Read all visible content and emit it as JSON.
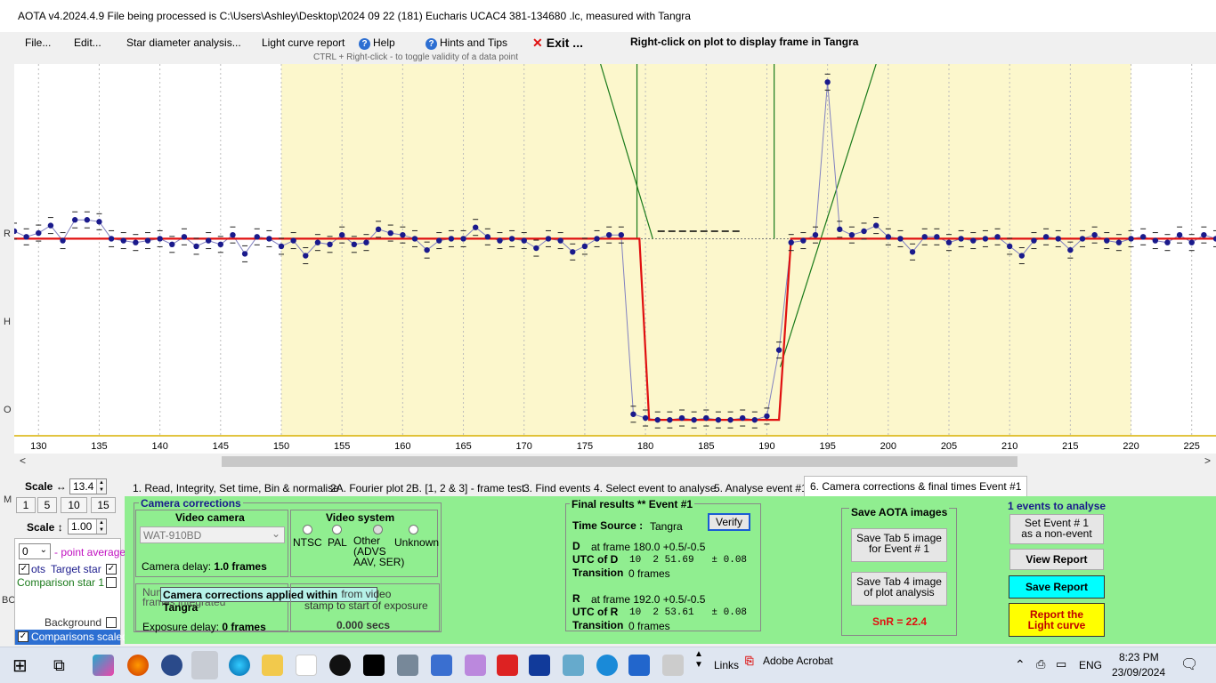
{
  "window": {
    "title": "AOTA v4.2024.4.9   File being processed is C:\\Users\\Ashley\\Desktop\\2024 09 22 (181) Eucharis UCAC4 381-134680 .lc, measured with Tangra"
  },
  "menu": {
    "file": "File...",
    "edit": "Edit...",
    "star_diameter": "Star diameter analysis...",
    "light_curve_report": "Light curve report",
    "help": "Help",
    "hints": "Hints and Tips",
    "exit": "Exit ...",
    "ctrl_hint": "CTRL + Right-click   -  to toggle validity of a data point",
    "right_click_note": "Right-click on plot to display frame in Tangra"
  },
  "left_strip_letters": [
    "R",
    "H",
    "O",
    "M",
    "BC"
  ],
  "plot": {
    "colors": {
      "background": "#ffffff",
      "event_region": "#fcf7cc",
      "data": "#1a1a8c",
      "model": "#e01010",
      "fit_lines": "#1a7a1a",
      "axis": "#d8b000"
    },
    "x_tick_labels": [
      "130",
      "135",
      "140",
      "145",
      "150",
      "155",
      "160",
      "165",
      "170",
      "175",
      "180",
      "185",
      "190",
      "195",
      "200",
      "205",
      "210",
      "215",
      "220",
      "225"
    ]
  },
  "chart_data": {
    "type": "line",
    "xlabel": "",
    "ylabel": "",
    "xlim": [
      128,
      227
    ],
    "ylim": [
      -0.05,
      2.0
    ],
    "event_region_x": [
      150,
      220
    ],
    "series": [
      {
        "values_x": [
          128,
          129,
          130,
          131,
          132,
          133,
          134,
          135,
          136,
          137,
          138,
          139,
          140,
          141,
          142,
          143,
          144,
          145,
          146,
          147,
          148,
          149,
          150,
          151,
          152,
          153,
          154,
          155,
          156,
          157,
          158,
          159,
          160,
          161,
          162,
          163,
          164,
          165,
          166,
          167,
          168,
          169,
          170,
          171,
          172,
          173,
          174,
          175,
          176,
          177,
          178,
          179,
          180,
          181,
          182,
          183,
          184,
          185,
          186,
          187,
          188,
          189,
          190,
          191,
          192,
          193,
          194,
          195,
          196,
          197,
          198,
          199,
          200,
          201,
          202,
          203,
          204,
          205,
          206,
          207,
          208,
          209,
          210,
          211,
          212,
          213,
          214,
          215,
          216,
          217,
          218,
          219,
          220,
          221,
          222,
          223,
          224,
          225,
          226,
          227
        ],
        "values_y": [
          1.02,
          0.99,
          1.01,
          1.05,
          0.97,
          1.08,
          1.08,
          1.07,
          0.98,
          0.97,
          0.96,
          0.97,
          0.98,
          0.95,
          0.99,
          0.94,
          0.97,
          0.95,
          1.0,
          0.9,
          0.99,
          0.98,
          0.94,
          0.97,
          0.89,
          0.96,
          0.95,
          1.0,
          0.95,
          0.96,
          1.03,
          1.01,
          1.0,
          0.98,
          0.92,
          0.97,
          0.98,
          0.98,
          1.04,
          0.99,
          0.97,
          0.98,
          0.97,
          0.93,
          0.98,
          0.97,
          0.91,
          0.94,
          0.98,
          1.0,
          1.0,
          0.05,
          0.03,
          0.02,
          0.02,
          0.03,
          0.02,
          0.03,
          0.02,
          0.02,
          0.03,
          0.02,
          0.04,
          0.39,
          0.96,
          0.97,
          1.0,
          1.81,
          1.03,
          1.0,
          1.02,
          1.05,
          0.99,
          0.98,
          0.91,
          0.99,
          0.99,
          0.96,
          0.98,
          0.97,
          0.98,
          0.99,
          0.94,
          0.89,
          0.97,
          0.99,
          0.98,
          0.92,
          0.98,
          1.0,
          0.97,
          0.96,
          0.98,
          0.99,
          0.97,
          0.96,
          1.0,
          0.96,
          1.0,
          0.98
        ]
      },
      {
        "values_x": [
          128,
          179.5,
          180.3,
          191.0,
          192.0,
          227
        ],
        "values_y": [
          0.98,
          0.98,
          0.02,
          0.02,
          0.98,
          0.98
        ]
      }
    ],
    "d_frame": 180.0,
    "r_frame": 192.0
  },
  "scale_panel": {
    "scale_h_label": "Scale ↔",
    "scale_h_value": "13.4",
    "zoom_buttons": [
      "1",
      "5",
      "10",
      "15"
    ],
    "scale_v_label": "Scale ↕",
    "scale_v_value": "1.00",
    "point_avg_value": "0",
    "point_avg_label": "- point average",
    "pts_label": "ots",
    "target_star_label": "Target star",
    "comparison_star_label": "Comparison star 1",
    "background_label": "Background",
    "comparisons_scaled_label": "Comparisons scaled"
  },
  "tabs": [
    "1.  Read, Integrity, Set time, Bin & normalise",
    "2A. Fourier plot",
    "2B. [1, 2 & 3] - frame test",
    "3. Find events",
    "4. Select event to analyse",
    "5. Analyse event #1",
    "6. Camera corrections & final times Event #1"
  ],
  "camera": {
    "group_title": "Camera corrections",
    "video_camera_title": "Video camera",
    "camera_value": "WAT-910BD",
    "camera_delay_label": "Camera delay:",
    "camera_delay_value": "1.0 frames",
    "video_system_title": "Video system",
    "video_options": [
      "NTSC",
      "PAL",
      "Other\n(ADVS\nAAV, SER)",
      "Unknown"
    ],
    "num_frames_label": "Num\nframes integrated",
    "tooltip": "Camera corrections applied within Tangra",
    "from_video_stamp": "from video\nstamp to start of exposure",
    "offset_secs": "0.000 secs",
    "exposure_delay_label": "Exposure delay:",
    "exposure_delay_value": "0 frames"
  },
  "final": {
    "title": "Final results  **  Event #1",
    "time_source_label": "Time Source :",
    "time_source_value": "Tangra",
    "verify": "Verify",
    "d_label": "D",
    "d_frame": "at frame 180.0  +0.5/-0.5",
    "utc_d_label": "UTC of D",
    "utc_d_value": "10  2 51.69   ± 0.08",
    "transition_label": "Transition",
    "transition_d_value": "0 frames",
    "r_label": "R",
    "r_frame": "at frame 192.0  +0.5/-0.5",
    "utc_r_label": "UTC of R",
    "utc_r_value": "10  2 53.61   ± 0.08",
    "transition_r_value": "0 frames"
  },
  "save_images": {
    "title": "Save AOTA images",
    "tab5": "Save Tab 5 image\nfor Event # 1",
    "tab4": "Save Tab 4 image\nof plot analysis",
    "snr": "SnR = 22.4"
  },
  "events": {
    "count_label": "1  events to analyse",
    "set_non_event": "Set Event # 1\nas a non-event",
    "view_report": "View Report",
    "save_report": "Save Report",
    "report_light_curve": "Report the\nLight curve"
  },
  "taskbar": {
    "links": "Links",
    "acrobat": "Adobe Acrobat",
    "lang": "ENG",
    "time": "8:23 PM",
    "date": "23/09/2024"
  }
}
